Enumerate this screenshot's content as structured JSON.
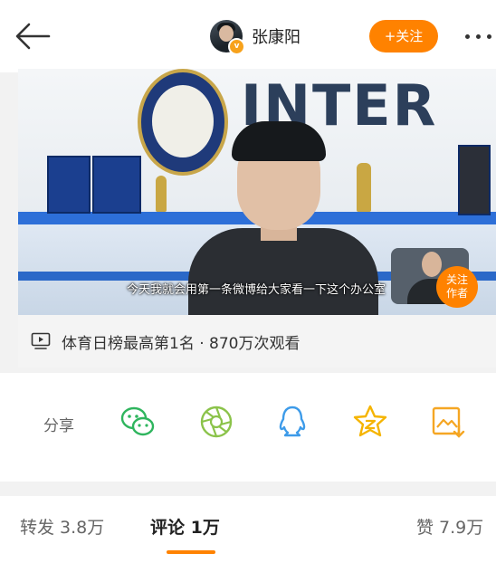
{
  "header": {
    "username": "张康阳",
    "verified_badge": "v",
    "follow_label": "+关注"
  },
  "video": {
    "logo_text": "INTER",
    "subtitle": "今天我就会用第一条微博给大家看一下这个办公室",
    "pip_follow_label": "关注\n作者"
  },
  "info": {
    "text": "体育日榜最高第1名 · 870万次观看"
  },
  "share": {
    "label": "分享",
    "icons": [
      "wechat-icon",
      "moments-icon",
      "qq-icon",
      "qzone-icon",
      "save-image-icon"
    ]
  },
  "tabs": {
    "repost": "转发 3.8万",
    "comment": "评论 1万",
    "like": "赞 7.9万"
  },
  "colors": {
    "accent": "#ff8200",
    "wechat": "#2fb55e",
    "moments": "#8bc34a",
    "qq": "#3d9be9",
    "qzone": "#f5b400"
  }
}
